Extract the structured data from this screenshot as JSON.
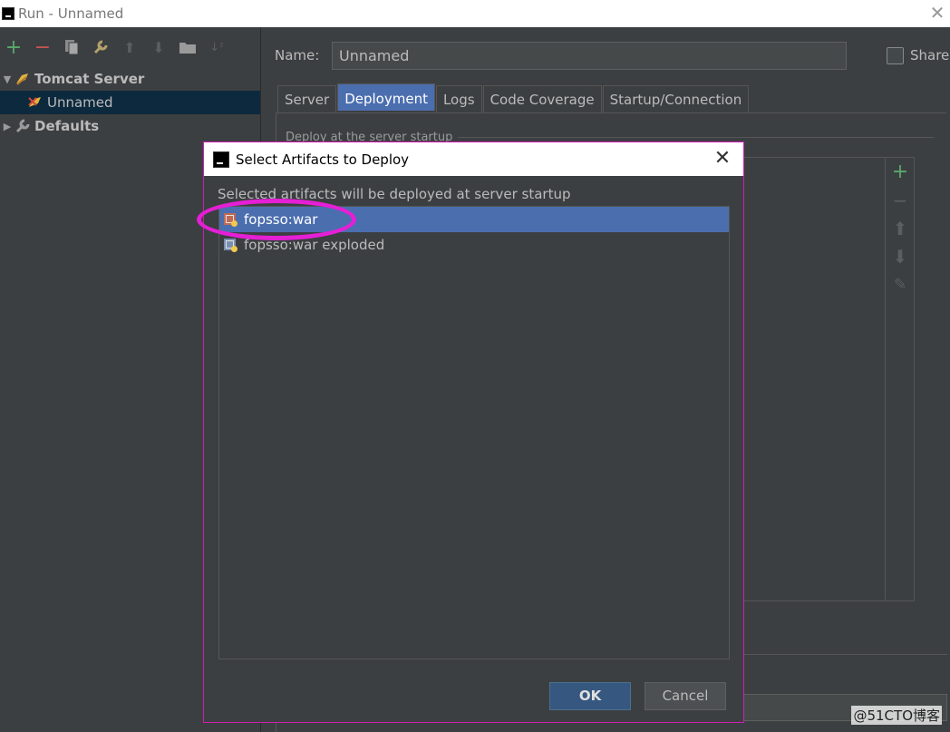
{
  "window": {
    "title": "Run - Unnamed"
  },
  "toolbar": {
    "icons": [
      "add-icon",
      "remove-icon",
      "copy-icon",
      "wrench-icon",
      "move-up-icon",
      "move-down-icon",
      "folder-icon",
      "sort-icon"
    ],
    "colors": {
      "add": "#59a869",
      "remove": "#c75450"
    }
  },
  "tree": {
    "items": [
      {
        "label": "Tomcat Server",
        "expanded": true,
        "bold": true
      },
      {
        "label": "Unnamed",
        "selected": true
      },
      {
        "label": "Defaults",
        "expanded": false,
        "bold": true
      }
    ]
  },
  "config": {
    "name_label": "Name:",
    "name_value": "Unnamed",
    "share_label": "Share",
    "share_checked": false
  },
  "tabs": [
    "Server",
    "Deployment",
    "Logs",
    "Code Coverage",
    "Startup/Connection"
  ],
  "active_tab": "Deployment",
  "deployment": {
    "section_label": "Deploy at the server startup"
  },
  "dialog": {
    "title": "Select Artifacts to Deploy",
    "subtitle": "Selected artifacts will be deployed at server startup",
    "artifacts": [
      {
        "label": "fopsso:war",
        "selected": true
      },
      {
        "label": "fopsso:war exploded",
        "selected": false
      }
    ],
    "ok_label": "OK",
    "cancel_label": "Cancel",
    "border_color": "#d11cb4",
    "highlight_color": "#e51fd6"
  },
  "watermark": "@51CTO博客"
}
